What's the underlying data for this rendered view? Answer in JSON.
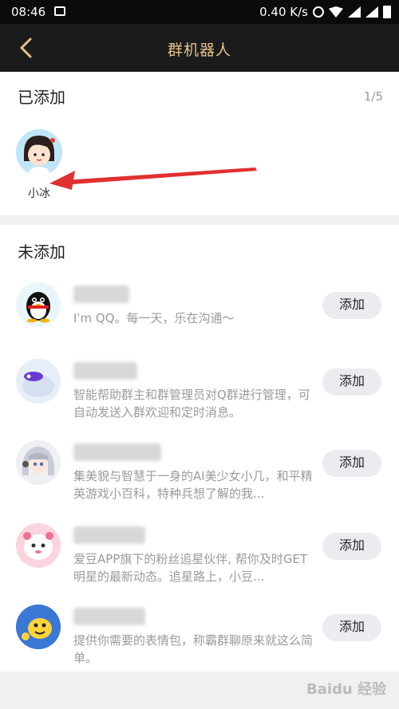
{
  "status": {
    "time": "08:46",
    "speed": "0.40 K/s"
  },
  "nav": {
    "title": "群机器人"
  },
  "added": {
    "heading": "已添加",
    "count": "1/5",
    "items": [
      {
        "name": "小冰"
      }
    ]
  },
  "not_added": {
    "heading": "未添加",
    "items": [
      {
        "desc": "I'm QQ。每一天，乐在沟通～",
        "button": "添加"
      },
      {
        "desc": "智能帮助群主和群管理员对Q群进行管理，可自动发送入群欢迎和定时消息。",
        "button": "添加"
      },
      {
        "desc": "集美貌与智慧于一身的AI美少女小几，和平精英游戏小百科，特种兵想了解的我...",
        "button": "添加"
      },
      {
        "desc": "爱豆APP旗下的粉丝追星伙伴, 帮你及时GET明星的最新动态。追星路上，小豆...",
        "button": "添加"
      },
      {
        "desc": "提供你需要的表情包，称霸群聊原来就这么简单。",
        "button": "添加"
      }
    ]
  },
  "watermark": "Baidu 经验",
  "colors": {
    "nav_bg": "#1b1b1b",
    "nav_title": "#e5c28a",
    "button_bg": "#ececf0"
  }
}
